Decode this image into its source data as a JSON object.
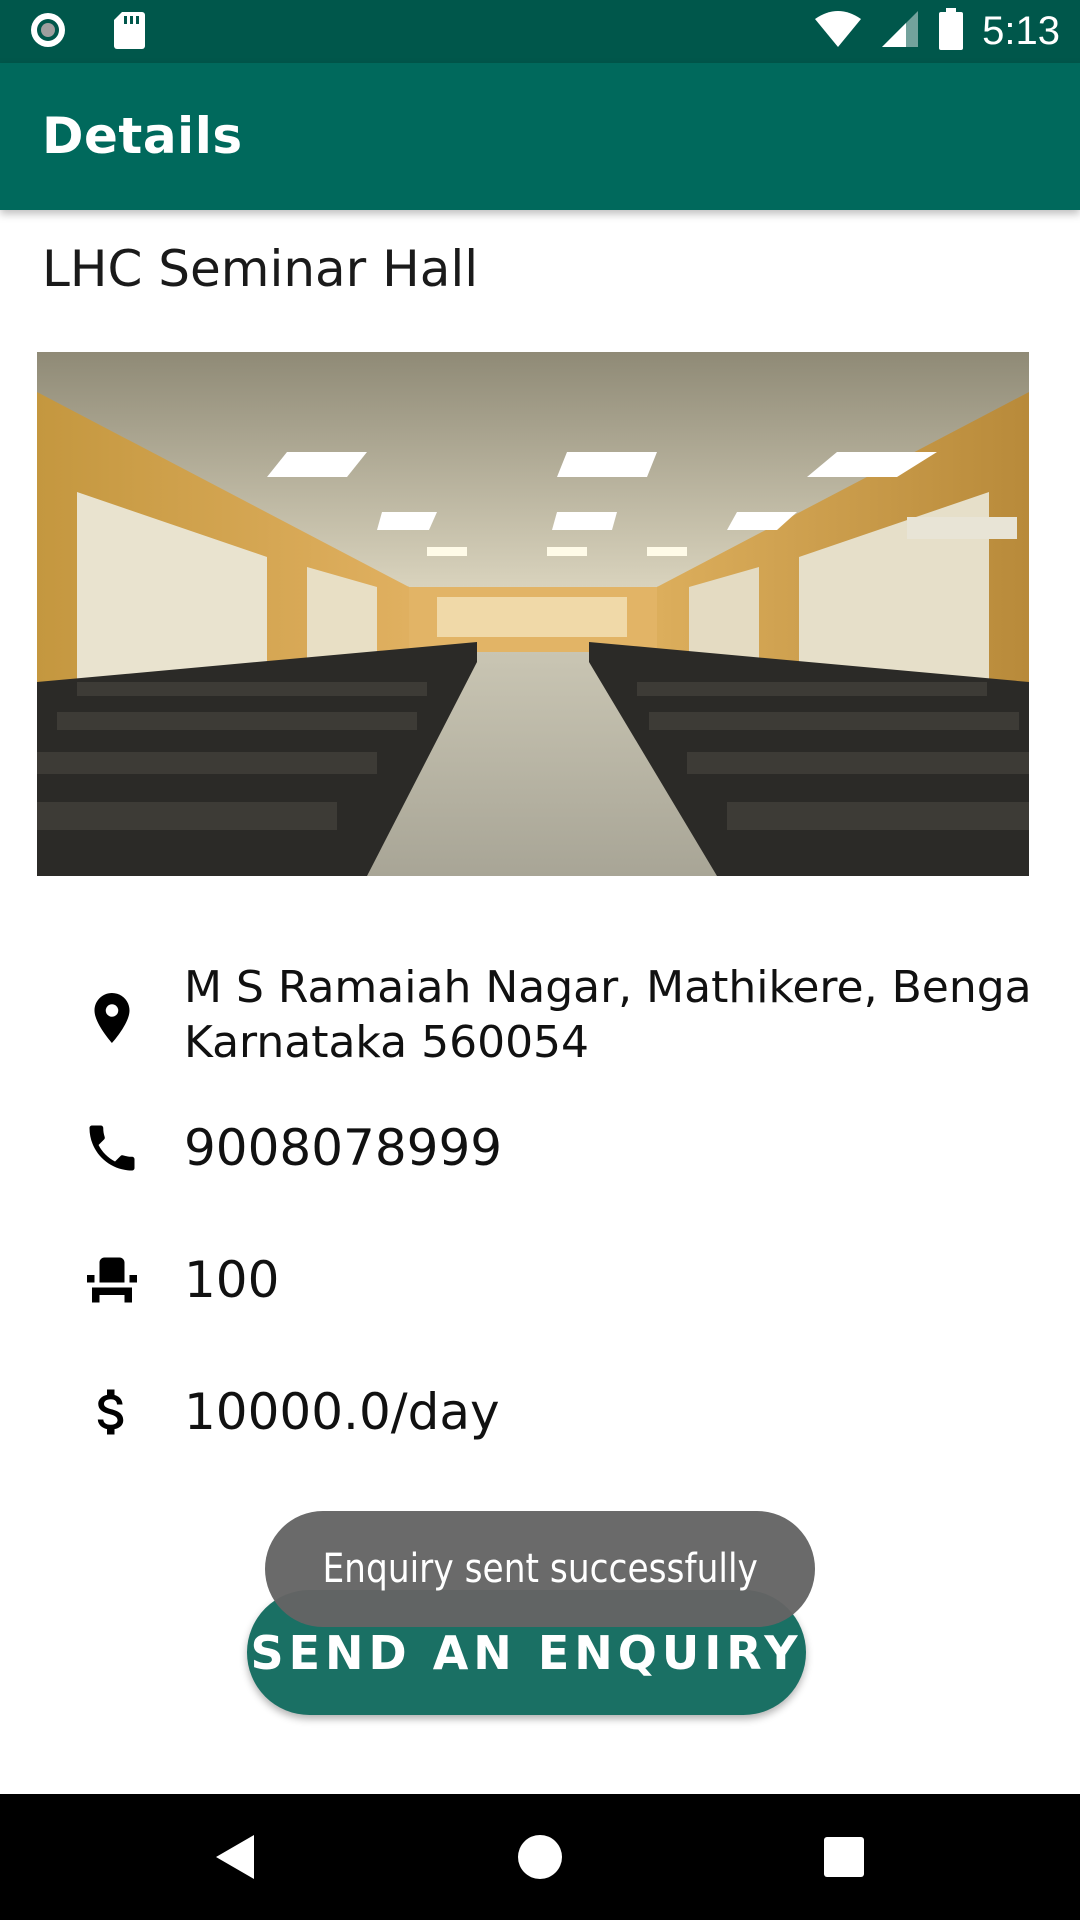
{
  "status_bar": {
    "time": "5:13",
    "left_icons": [
      "notification-dot-icon",
      "sd-card-icon"
    ],
    "right_icons": [
      "wifi-icon",
      "cell-signal-icon",
      "battery-icon"
    ]
  },
  "app_bar": {
    "title": "Details"
  },
  "venue": {
    "name": "LHC Seminar Hall",
    "photo_icon": "seminar-hall-photo"
  },
  "details": {
    "address": {
      "icon": "location-pin-icon",
      "line1": "M S Ramaiah Nagar, Mathikere, Bengalur",
      "line2": "Karnataka 560054"
    },
    "phone": {
      "icon": "phone-icon",
      "value": "9008078999"
    },
    "capacity": {
      "icon": "seat-icon",
      "value": "100"
    },
    "price": {
      "icon": "dollar-icon",
      "value": "10000.0/day"
    }
  },
  "toast": {
    "message": "Enquiry sent successfully"
  },
  "actions": {
    "enquiry_label": "SEND AN ENQUIRY"
  },
  "nav_bar": {
    "icons": [
      "back-icon",
      "home-icon",
      "recents-icon"
    ]
  },
  "colors": {
    "status_bar": "#00574b",
    "app_bar": "#00695c",
    "button": "#1a7064",
    "toast": "#646464"
  }
}
